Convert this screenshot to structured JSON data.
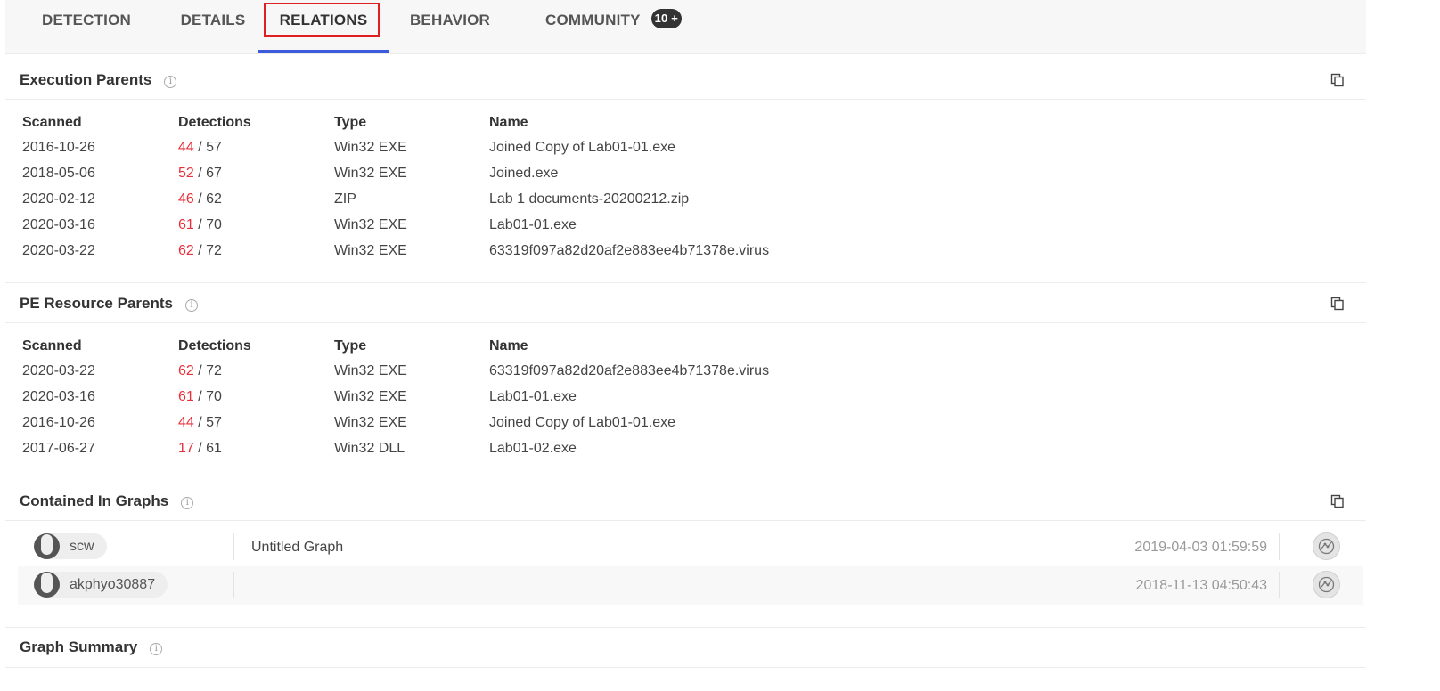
{
  "tabs": [
    {
      "label": "DETECTION"
    },
    {
      "label": "DETAILS"
    },
    {
      "label": "RELATIONS"
    },
    {
      "label": "BEHAVIOR"
    },
    {
      "label": "COMMUNITY",
      "badge": "10 +"
    }
  ],
  "active_tab": "RELATIONS",
  "colors": {
    "accent": "#3b5bdb",
    "highlight": "#e02020",
    "positive": "#e8303a"
  },
  "table_columns": [
    "Scanned",
    "Detections",
    "Type",
    "Name"
  ],
  "execution_parents": {
    "title": "Execution Parents",
    "rows": [
      {
        "scanned": "2016-10-26",
        "positives": "44",
        "total": "57",
        "type": "Win32 EXE",
        "name": "Joined Copy of Lab01-01.exe"
      },
      {
        "scanned": "2018-05-06",
        "positives": "52",
        "total": "67",
        "type": "Win32 EXE",
        "name": "Joined.exe"
      },
      {
        "scanned": "2020-02-12",
        "positives": "46",
        "total": "62",
        "type": "ZIP",
        "name": "Lab 1 documents-20200212.zip"
      },
      {
        "scanned": "2020-03-16",
        "positives": "61",
        "total": "70",
        "type": "Win32 EXE",
        "name": "Lab01-01.exe"
      },
      {
        "scanned": "2020-03-22",
        "positives": "62",
        "total": "72",
        "type": "Win32 EXE",
        "name": "63319f097a82d20af2e883ee4b71378e.virus"
      }
    ]
  },
  "pe_resource_parents": {
    "title": "PE Resource Parents",
    "rows": [
      {
        "scanned": "2020-03-22",
        "positives": "62",
        "total": "72",
        "type": "Win32 EXE",
        "name": "63319f097a82d20af2e883ee4b71378e.virus"
      },
      {
        "scanned": "2020-03-16",
        "positives": "61",
        "total": "70",
        "type": "Win32 EXE",
        "name": "Lab01-01.exe"
      },
      {
        "scanned": "2016-10-26",
        "positives": "44",
        "total": "57",
        "type": "Win32 EXE",
        "name": "Joined Copy of Lab01-01.exe"
      },
      {
        "scanned": "2017-06-27",
        "positives": "17",
        "total": "61",
        "type": "Win32 DLL",
        "name": "Lab01-02.exe"
      }
    ]
  },
  "contained_in_graphs": {
    "title": "Contained In Graphs",
    "rows": [
      {
        "user": "scw",
        "graph": "Untitled Graph",
        "date": "2019-04-03 01:59:59"
      },
      {
        "user": "akphyo30887",
        "graph": "",
        "date": "2018-11-13 04:50:43"
      }
    ]
  },
  "graph_summary": {
    "title": "Graph Summary"
  },
  "icons": {
    "info": "info-icon",
    "copy": "copy-icon",
    "graph": "graph-icon",
    "avatar": "avatar"
  }
}
